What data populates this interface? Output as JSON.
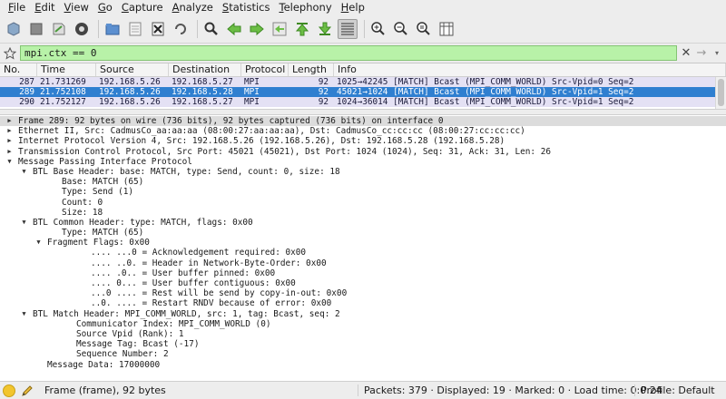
{
  "menu": [
    "File",
    "Edit",
    "View",
    "Go",
    "Capture",
    "Analyze",
    "Statistics",
    "Telephony",
    "Help"
  ],
  "filter": {
    "value": "mpi.ctx == 0"
  },
  "packet_list": {
    "columns": [
      "No.",
      "Time",
      "Source",
      "Destination",
      "Protocol",
      "Length",
      "Info"
    ],
    "rows": [
      {
        "no": "287",
        "time": "21.731269",
        "src": "192.168.5.26",
        "dst": "192.168.5.27",
        "proto": "MPI",
        "len": "92",
        "info": "1025→42245 [MATCH] Bcast (MPI_COMM_WORLD) Src-Vpid=0 Seq=2",
        "selected": false
      },
      {
        "no": "289",
        "time": "21.752108",
        "src": "192.168.5.26",
        "dst": "192.168.5.28",
        "proto": "MPI",
        "len": "92",
        "info": "45021→1024 [MATCH] Bcast (MPI_COMM_WORLD) Src-Vpid=1 Seq=2",
        "selected": true
      },
      {
        "no": "290",
        "time": "21.752127",
        "src": "192.168.5.26",
        "dst": "192.168.5.27",
        "proto": "MPI",
        "len": "92",
        "info": "1024→36014 [MATCH] Bcast (MPI_COMM_WORLD) Src-Vpid=1 Seq=2",
        "selected": false
      }
    ]
  },
  "details": [
    {
      "level": 0,
      "arrow": "right",
      "text": "Frame 289: 92 bytes on wire (736 bits), 92 bytes captured (736 bits) on interface 0",
      "hl": true
    },
    {
      "level": 0,
      "arrow": "right",
      "text": "Ethernet II, Src: CadmusCo_aa:aa:aa (08:00:27:aa:aa:aa), Dst: CadmusCo_cc:cc:cc (08:00:27:cc:cc:cc)"
    },
    {
      "level": 0,
      "arrow": "right",
      "text": "Internet Protocol Version 4, Src: 192.168.5.26 (192.168.5.26), Dst: 192.168.5.28 (192.168.5.28)"
    },
    {
      "level": 0,
      "arrow": "right",
      "text": "Transmission Control Protocol, Src Port: 45021 (45021), Dst Port: 1024 (1024), Seq: 31, Ack: 31, Len: 26"
    },
    {
      "level": 0,
      "arrow": "down",
      "text": "Message Passing Interface Protocol"
    },
    {
      "level": 1,
      "arrow": "down",
      "text": "BTL Base Header: base: MATCH, type: Send, count: 0, size: 18"
    },
    {
      "level": 3,
      "arrow": "",
      "text": "Base: MATCH (65)"
    },
    {
      "level": 3,
      "arrow": "",
      "text": "Type: Send (1)"
    },
    {
      "level": 3,
      "arrow": "",
      "text": "Count: 0"
    },
    {
      "level": 3,
      "arrow": "",
      "text": "Size: 18"
    },
    {
      "level": 1,
      "arrow": "down",
      "text": "BTL Common Header: type: MATCH, flags: 0x00"
    },
    {
      "level": 3,
      "arrow": "",
      "text": "Type: MATCH (65)"
    },
    {
      "level": 2,
      "arrow": "down",
      "text": "Fragment Flags: 0x00"
    },
    {
      "level": 5,
      "arrow": "",
      "text": ".... ...0 = Acknowledgement required: 0x00"
    },
    {
      "level": 5,
      "arrow": "",
      "text": ".... ..0. = Header in Network-Byte-Order: 0x00"
    },
    {
      "level": 5,
      "arrow": "",
      "text": ".... .0.. = User buffer pinned: 0x00"
    },
    {
      "level": 5,
      "arrow": "",
      "text": ".... 0... = User buffer contiguous: 0x00"
    },
    {
      "level": 5,
      "arrow": "",
      "text": "...0 .... = Rest will be send by copy-in-out: 0x00"
    },
    {
      "level": 5,
      "arrow": "",
      "text": "..0. .... = Restart RNDV because of error: 0x00"
    },
    {
      "level": 1,
      "arrow": "down",
      "text": "BTL Match Header: MPI_COMM_WORLD, src: 1, tag: Bcast, seq: 2"
    },
    {
      "level": 4,
      "arrow": "",
      "text": "Communicator Index: MPI_COMM_WORLD (0)"
    },
    {
      "level": 4,
      "arrow": "",
      "text": "Source Vpid (Rank): 1"
    },
    {
      "level": 4,
      "arrow": "",
      "text": "Message Tag: Bcast (-17)"
    },
    {
      "level": 4,
      "arrow": "",
      "text": "Sequence Number: 2"
    },
    {
      "level": 2,
      "arrow": "",
      "text": "Message Data: 17000000"
    }
  ],
  "status": {
    "frame": "Frame (frame), 92 bytes",
    "packets": "Packets: 379 · Displayed: 19 · Marked: 0 · Load time: 0:0.24",
    "profile": "Profile: Default"
  }
}
